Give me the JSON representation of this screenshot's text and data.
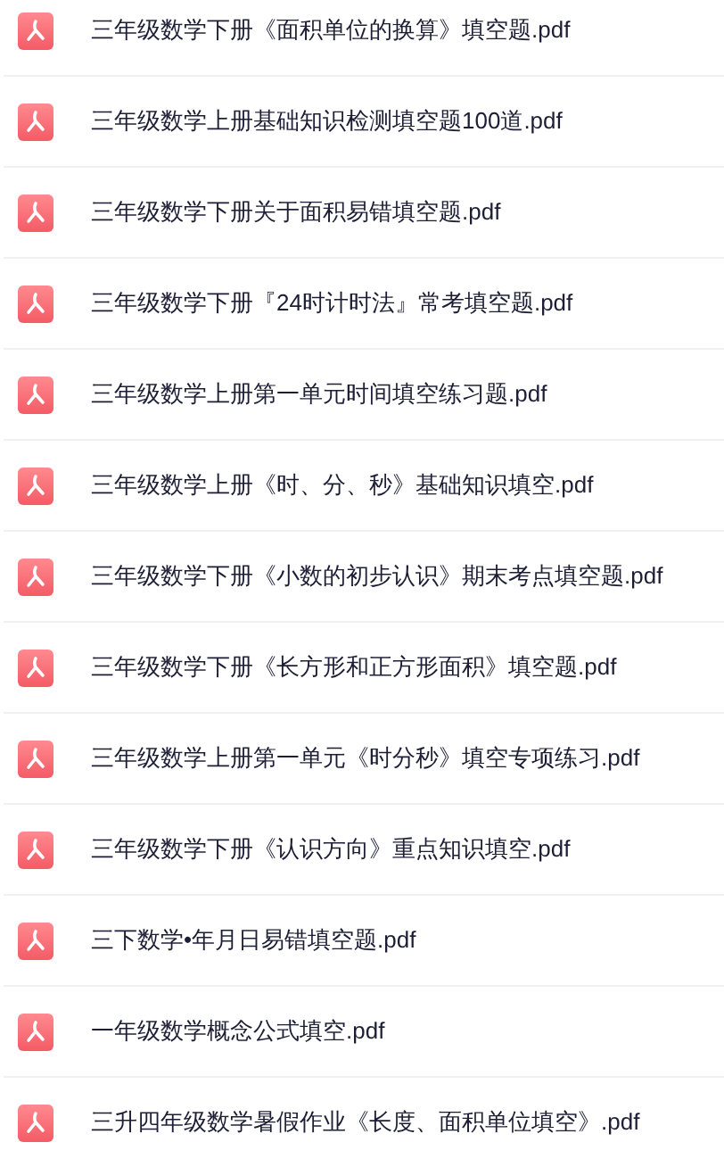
{
  "files": [
    {
      "name": "三年级数学下册《面积单位的换算》填空题.pdf"
    },
    {
      "name": "三年级数学上册基础知识检测填空题100道.pdf"
    },
    {
      "name": "三年级数学下册关于面积易错填空题.pdf"
    },
    {
      "name": "三年级数学下册『24时计时法』常考填空题.pdf"
    },
    {
      "name": "三年级数学上册第一单元时间填空练习题.pdf"
    },
    {
      "name": "三年级数学上册《时、分、秒》基础知识填空.pdf"
    },
    {
      "name": "三年级数学下册《小数的初步认识》期末考点填空题.pdf"
    },
    {
      "name": "三年级数学下册《长方形和正方形面积》填空题.pdf"
    },
    {
      "name": "三年级数学上册第一单元《时分秒》填空专项练习.pdf"
    },
    {
      "name": "三年级数学下册《认识方向》重点知识填空.pdf"
    },
    {
      "name": "三下数学•年月日易错填空题.pdf"
    },
    {
      "name": "一年级数学概念公式填空.pdf"
    },
    {
      "name": "三升四年级数学暑假作业《长度、面积单位填空》.pdf"
    }
  ]
}
